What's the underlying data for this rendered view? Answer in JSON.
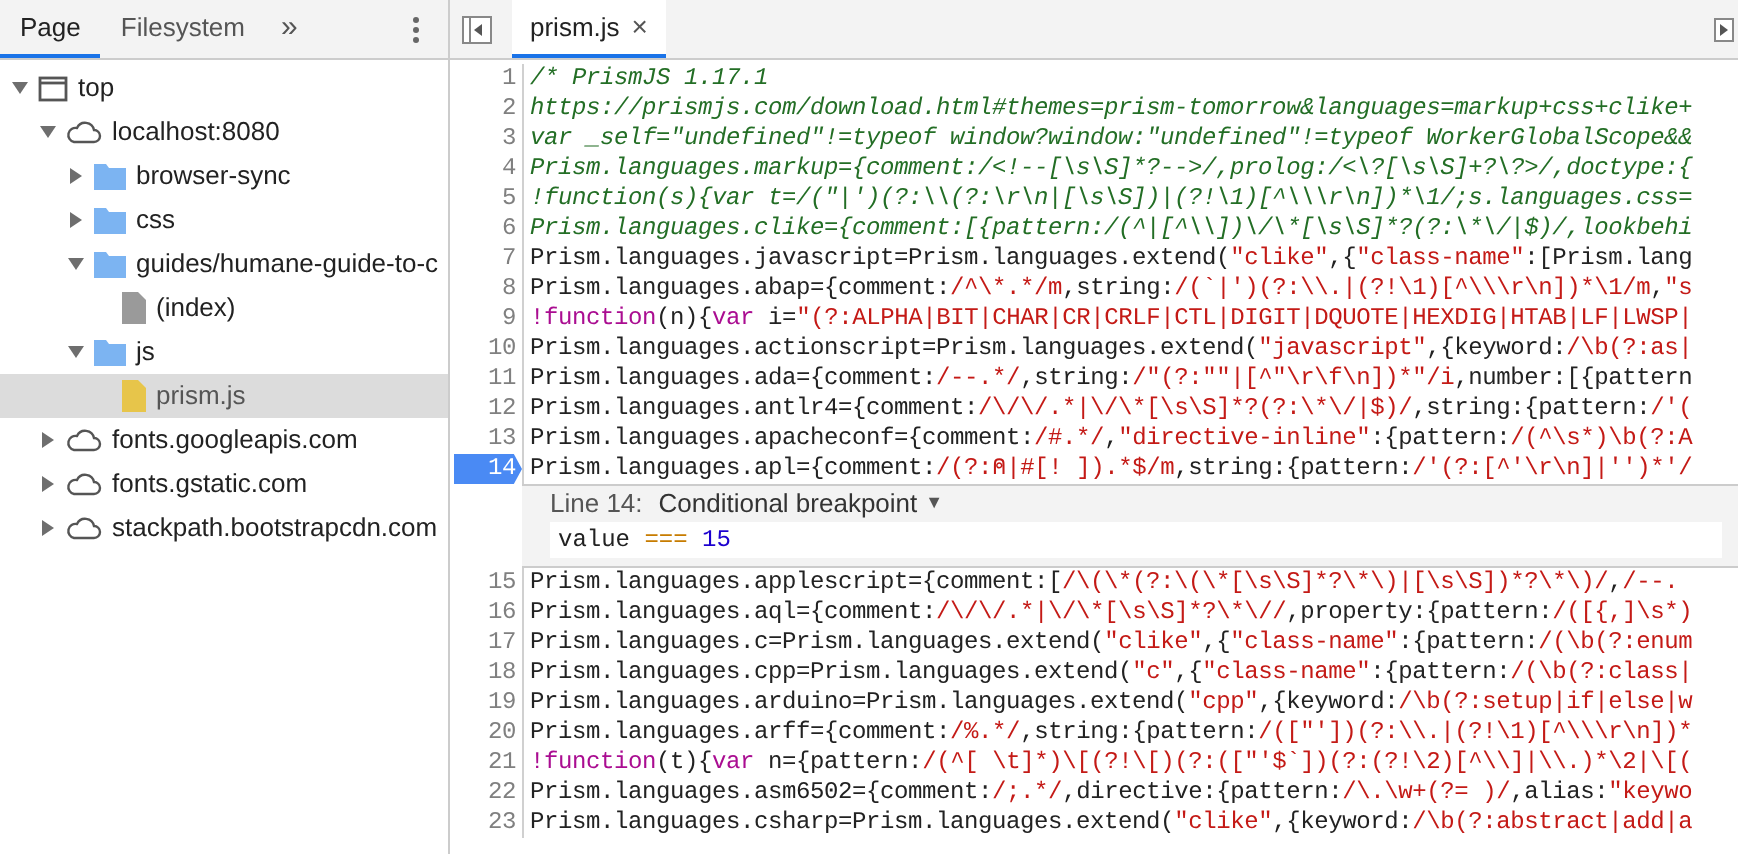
{
  "navigator": {
    "tabs": [
      {
        "label": "Page",
        "selected": true
      },
      {
        "label": "Filesystem",
        "selected": false
      }
    ],
    "more": "»",
    "tree": [
      {
        "label": "top",
        "kind": "frame",
        "expanded": true,
        "selected": false,
        "children": [
          {
            "label": "localhost:8080",
            "kind": "domain",
            "expanded": true,
            "selected": false,
            "children": [
              {
                "label": "browser-sync",
                "kind": "folder",
                "expanded": false,
                "selected": false
              },
              {
                "label": "css",
                "kind": "folder",
                "expanded": false,
                "selected": false
              },
              {
                "label": "guides/humane-guide-to-c",
                "kind": "folder",
                "expanded": true,
                "selected": false,
                "children": [
                  {
                    "label": "(index)",
                    "kind": "document",
                    "selected": false
                  }
                ]
              },
              {
                "label": "js",
                "kind": "folder",
                "expanded": true,
                "selected": false,
                "children": [
                  {
                    "label": "prism.js",
                    "kind": "script",
                    "selected": true
                  }
                ]
              }
            ]
          },
          {
            "label": "fonts.googleapis.com",
            "kind": "domain",
            "expanded": false,
            "selected": false
          },
          {
            "label": "fonts.gstatic.com",
            "kind": "domain",
            "expanded": false,
            "selected": false
          },
          {
            "label": "stackpath.bootstrapcdn.com",
            "kind": "domain",
            "expanded": false,
            "selected": false
          }
        ]
      }
    ]
  },
  "editor": {
    "tabs": [
      {
        "label": "prism.js",
        "close": "×",
        "selected": true
      }
    ],
    "lines": [
      {
        "number": "1",
        "breakpoint": false,
        "segments": [
          {
            "kind": "comment",
            "text": "/* PrismJS 1.17.1"
          }
        ]
      },
      {
        "number": "2",
        "breakpoint": false,
        "segments": [
          {
            "kind": "comment",
            "text": "https://prismjs.com/download.html#themes=prism-tomorrow&languages=markup+css+clike+"
          }
        ]
      },
      {
        "number": "3",
        "breakpoint": false,
        "segments": [
          {
            "kind": "comment",
            "text": "var _self=\"undefined\"!=typeof window?window:\"undefined\"!=typeof WorkerGlobalScope&&"
          }
        ]
      },
      {
        "number": "4",
        "breakpoint": false,
        "segments": [
          {
            "kind": "comment",
            "text": "Prism.languages.markup={comment:/<!--[\\s\\S]*?-->/,prolog:/<\\?[\\s\\S]+?\\?>/,doctype:{"
          }
        ]
      },
      {
        "number": "5",
        "breakpoint": false,
        "segments": [
          {
            "kind": "comment",
            "text": "!function(s){var t=/(\"|')(?:\\\\(?:\\r\\n|[\\s\\S])|(?!\\1)[^\\\\\\r\\n])*\\1/;s.languages.css="
          }
        ]
      },
      {
        "number": "6",
        "breakpoint": false,
        "segments": [
          {
            "kind": "comment",
            "text": "Prism.languages.clike={comment:[{pattern:/(^|[^\\\\])\\/\\*[\\s\\S]*?(?:\\*\\/|$)/,lookbehi"
          }
        ]
      },
      {
        "number": "7",
        "breakpoint": false,
        "segments": [
          {
            "kind": "plain",
            "text": "Prism.languages.javascript=Prism.languages.extend("
          },
          {
            "kind": "string",
            "text": "\"clike\""
          },
          {
            "kind": "plain",
            "text": ",{"
          },
          {
            "kind": "string",
            "text": "\"class-name\""
          },
          {
            "kind": "plain",
            "text": ":[Prism.lang"
          }
        ]
      },
      {
        "number": "8",
        "breakpoint": false,
        "segments": [
          {
            "kind": "plain",
            "text": "Prism.languages.abap={comment:"
          },
          {
            "kind": "string",
            "text": "/^\\*.*/m"
          },
          {
            "kind": "plain",
            "text": ",string:"
          },
          {
            "kind": "string",
            "text": "/(`|')(?:\\\\.|(?!\\1)[^\\\\\\r\\n])*\\1/m"
          },
          {
            "kind": "plain",
            "text": ","
          },
          {
            "kind": "string",
            "text": "\"s"
          }
        ]
      },
      {
        "number": "9",
        "breakpoint": false,
        "segments": [
          {
            "kind": "keyword",
            "text": "!function"
          },
          {
            "kind": "plain",
            "text": "(n){"
          },
          {
            "kind": "keyword",
            "text": "var"
          },
          {
            "kind": "plain",
            "text": " i="
          },
          {
            "kind": "string",
            "text": "\"(?:ALPHA|BIT|CHAR|CR|CRLF|CTL|DIGIT|DQUOTE|HEXDIG|HTAB|LF|LWSP|"
          }
        ]
      },
      {
        "number": "10",
        "breakpoint": false,
        "segments": [
          {
            "kind": "plain",
            "text": "Prism.languages.actionscript=Prism.languages.extend("
          },
          {
            "kind": "string",
            "text": "\"javascript\""
          },
          {
            "kind": "plain",
            "text": ",{keyword:"
          },
          {
            "kind": "string",
            "text": "/\\b(?:as|"
          }
        ]
      },
      {
        "number": "11",
        "breakpoint": false,
        "segments": [
          {
            "kind": "plain",
            "text": "Prism.languages.ada={comment:"
          },
          {
            "kind": "string",
            "text": "/--.*/"
          },
          {
            "kind": "plain",
            "text": ",string:"
          },
          {
            "kind": "string",
            "text": "/\"(?:\"\"|[^\"\\r\\f\\n])*\"/i"
          },
          {
            "kind": "plain",
            "text": ",number:[{pattern"
          }
        ]
      },
      {
        "number": "12",
        "breakpoint": false,
        "segments": [
          {
            "kind": "plain",
            "text": "Prism.languages.antlr4={comment:"
          },
          {
            "kind": "string",
            "text": "/\\/\\/.*|\\/\\*[\\s\\S]*?(?:\\*\\/|$)/"
          },
          {
            "kind": "plain",
            "text": ",string:{pattern:"
          },
          {
            "kind": "string",
            "text": "/'("
          }
        ]
      },
      {
        "number": "13",
        "breakpoint": false,
        "segments": [
          {
            "kind": "plain",
            "text": "Prism.languages.apacheconf={comment:"
          },
          {
            "kind": "string",
            "text": "/#.*/"
          },
          {
            "kind": "plain",
            "text": ","
          },
          {
            "kind": "string",
            "text": "\"directive-inline\""
          },
          {
            "kind": "plain",
            "text": ":{pattern:"
          },
          {
            "kind": "string",
            "text": "/(^\\s*)\\b(?:A"
          }
        ]
      },
      {
        "number": "14",
        "breakpoint": true,
        "segments": [
          {
            "kind": "plain",
            "text": "Prism.languages.apl={comment:"
          },
          {
            "kind": "string",
            "text": "/(?:⍝|#[! ]).*$/m"
          },
          {
            "kind": "plain",
            "text": ",string:{pattern:"
          },
          {
            "kind": "string",
            "text": "/'(?:[^'\\r\\n]|'')*'/"
          }
        ]
      },
      {
        "number": "15",
        "breakpoint": false,
        "segments": [
          {
            "kind": "plain",
            "text": "Prism.languages.applescript={comment:["
          },
          {
            "kind": "string",
            "text": "/\\(\\*(?:\\(\\*[\\s\\S]*?\\*\\)|[\\s\\S])*?\\*\\)/"
          },
          {
            "kind": "plain",
            "text": ","
          },
          {
            "kind": "string",
            "text": "/--."
          }
        ]
      },
      {
        "number": "16",
        "breakpoint": false,
        "segments": [
          {
            "kind": "plain",
            "text": "Prism.languages.aql={comment:"
          },
          {
            "kind": "string",
            "text": "/\\/\\/.*|\\/\\*[\\s\\S]*?\\*\\//"
          },
          {
            "kind": "plain",
            "text": ",property:{pattern:"
          },
          {
            "kind": "string",
            "text": "/([{,]\\s*)"
          }
        ]
      },
      {
        "number": "17",
        "breakpoint": false,
        "segments": [
          {
            "kind": "plain",
            "text": "Prism.languages.c=Prism.languages.extend("
          },
          {
            "kind": "string",
            "text": "\"clike\""
          },
          {
            "kind": "plain",
            "text": ",{"
          },
          {
            "kind": "string",
            "text": "\"class-name\""
          },
          {
            "kind": "plain",
            "text": ":{pattern:"
          },
          {
            "kind": "string",
            "text": "/(\\b(?:enum"
          }
        ]
      },
      {
        "number": "18",
        "breakpoint": false,
        "segments": [
          {
            "kind": "plain",
            "text": "Prism.languages.cpp=Prism.languages.extend("
          },
          {
            "kind": "string",
            "text": "\"c\""
          },
          {
            "kind": "plain",
            "text": ",{"
          },
          {
            "kind": "string",
            "text": "\"class-name\""
          },
          {
            "kind": "plain",
            "text": ":{pattern:"
          },
          {
            "kind": "string",
            "text": "/(\\b(?:class|"
          }
        ]
      },
      {
        "number": "19",
        "breakpoint": false,
        "segments": [
          {
            "kind": "plain",
            "text": "Prism.languages.arduino=Prism.languages.extend("
          },
          {
            "kind": "string",
            "text": "\"cpp\""
          },
          {
            "kind": "plain",
            "text": ",{keyword:"
          },
          {
            "kind": "string",
            "text": "/\\b(?:setup|if|else|w"
          }
        ]
      },
      {
        "number": "20",
        "breakpoint": false,
        "segments": [
          {
            "kind": "plain",
            "text": "Prism.languages.arff={comment:"
          },
          {
            "kind": "string",
            "text": "/%.*/"
          },
          {
            "kind": "plain",
            "text": ",string:{pattern:"
          },
          {
            "kind": "string",
            "text": "/([\"'])(?:\\\\.|(?!\\1)[^\\\\\\r\\n])*"
          }
        ]
      },
      {
        "number": "21",
        "breakpoint": false,
        "segments": [
          {
            "kind": "keyword",
            "text": "!function"
          },
          {
            "kind": "plain",
            "text": "(t){"
          },
          {
            "kind": "keyword",
            "text": "var"
          },
          {
            "kind": "plain",
            "text": " n={pattern:"
          },
          {
            "kind": "string",
            "text": "/(^[ \\t]*)\\[(?!\\[)(?:([\"'$`])(?:(?!\\2)[^\\\\]|\\\\.)*\\2|\\[("
          }
        ]
      },
      {
        "number": "22",
        "breakpoint": false,
        "segments": [
          {
            "kind": "plain",
            "text": "Prism.languages.asm6502={comment:"
          },
          {
            "kind": "string",
            "text": "/;.*/"
          },
          {
            "kind": "plain",
            "text": ",directive:{pattern:"
          },
          {
            "kind": "string",
            "text": "/\\.\\w+(?= )/"
          },
          {
            "kind": "plain",
            "text": ",alias:"
          },
          {
            "kind": "string",
            "text": "\"keywo"
          }
        ]
      },
      {
        "number": "23",
        "breakpoint": false,
        "segments": [
          {
            "kind": "plain",
            "text": "Prism.languages.csharp=Prism.languages.extend("
          },
          {
            "kind": "string",
            "text": "\"clike\""
          },
          {
            "kind": "plain",
            "text": ",{keyword:"
          },
          {
            "kind": "string",
            "text": "/\\b(?:abstract|add|a"
          }
        ]
      }
    ],
    "breakpoint_editor": {
      "label": "Line 14:",
      "type": "Conditional breakpoint",
      "caret": "▼",
      "condition": [
        {
          "kind": "plain",
          "text": "value "
        },
        {
          "kind": "operator",
          "text": "==="
        },
        {
          "kind": "number",
          "text": " 15"
        }
      ]
    }
  }
}
